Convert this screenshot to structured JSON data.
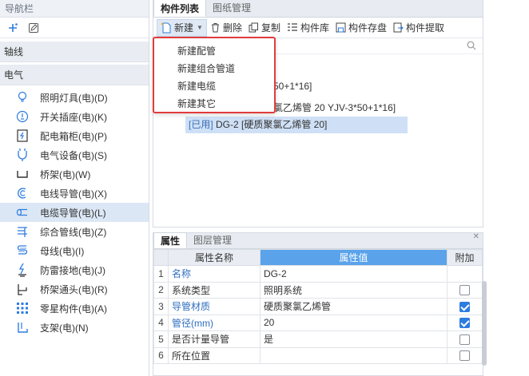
{
  "nav": {
    "header": "导航栏",
    "sections": {
      "axis": "轴线",
      "electric": "电气"
    },
    "items": [
      {
        "label": "照明灯具(电)(D)",
        "icon": "bulb-icon"
      },
      {
        "label": "开关插座(电)(K)",
        "icon": "switch-socket-icon"
      },
      {
        "label": "配电箱柜(电)(P)",
        "icon": "distribution-box-icon"
      },
      {
        "label": "电气设备(电)(S)",
        "icon": "electric-device-icon"
      },
      {
        "label": "桥架(电)(W)",
        "icon": "cable-tray-icon"
      },
      {
        "label": "电线导管(电)(X)",
        "icon": "wire-conduit-icon"
      },
      {
        "label": "电缆导管(电)(L)",
        "icon": "cable-conduit-icon",
        "active": true
      },
      {
        "label": "综合管线(电)(Z)",
        "icon": "combined-pipeline-icon"
      },
      {
        "label": "母线(电)(I)",
        "icon": "busbar-icon"
      },
      {
        "label": "防雷接地(电)(J)",
        "icon": "lightning-ground-icon"
      },
      {
        "label": "桥架通头(电)(R)",
        "icon": "tray-fitting-icon"
      },
      {
        "label": "零星构件(电)(A)",
        "icon": "misc-component-icon"
      },
      {
        "label": "支架(电)(N)",
        "icon": "bracket-icon"
      }
    ]
  },
  "top_tabs": [
    "构件列表",
    "图纸管理"
  ],
  "toolbar": {
    "new": "新建",
    "delete": "删除",
    "copy": "复制",
    "library": "构件库",
    "save": "构件存盘",
    "extract": "构件提取"
  },
  "new_menu": [
    "新建配管",
    "新建组合管道",
    "新建电缆",
    "新建其它"
  ],
  "tree": {
    "line1": "50+1*16]",
    "line2": "氯乙烯管 20 YJV-3*50+1*16]",
    "line3_tag": "[已用]",
    "line3_text": " DG-2 [硬质聚氯乙烯管 20]"
  },
  "bottom_tabs": [
    "属性",
    "图层管理"
  ],
  "props": {
    "headers": {
      "name": "属性名称",
      "value": "属性值",
      "extra": "附加"
    },
    "rows": [
      {
        "idx": "1",
        "name": "名称",
        "value": "DG-2",
        "blue": true,
        "check": null
      },
      {
        "idx": "2",
        "name": "系统类型",
        "value": "照明系统",
        "blue": false,
        "check": false
      },
      {
        "idx": "3",
        "name": "导管材质",
        "value": "硬质聚氯乙烯管",
        "blue": true,
        "check": true
      },
      {
        "idx": "4",
        "name": "管径(mm)",
        "value": "20",
        "blue": true,
        "check": true
      },
      {
        "idx": "5",
        "name": "是否计量导管",
        "value": "是",
        "blue": false,
        "check": false
      },
      {
        "idx": "6",
        "name": "所在位置",
        "value": "",
        "blue": false,
        "check": false
      }
    ]
  },
  "colors": {
    "accent": "#5aa3ea",
    "highlight": "#e23b3b",
    "selected_row": "#cfe0f6"
  }
}
